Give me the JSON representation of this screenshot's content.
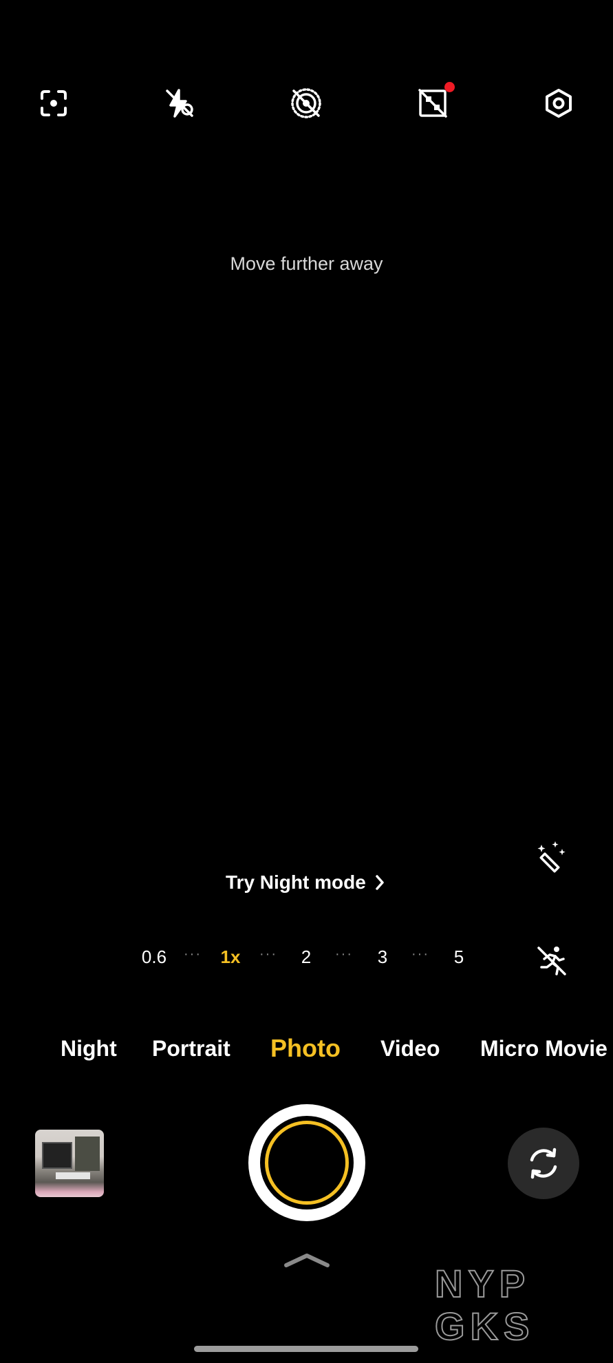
{
  "toolbar": {
    "items": [
      {
        "icon": "scan-icon"
      },
      {
        "icon": "flash-off-icon"
      },
      {
        "icon": "live-photo-off-icon"
      },
      {
        "icon": "aspect-ratio-off-icon",
        "badge_color": "#ef1b25"
      },
      {
        "icon": "settings-icon"
      }
    ]
  },
  "hint": "Move further away",
  "night_prompt": {
    "label": "Try Night mode"
  },
  "zoom": {
    "levels": [
      "0.6",
      "1x",
      "2",
      "3",
      "5"
    ],
    "active": "1x",
    "dots": "···"
  },
  "modes": {
    "items": [
      "Night",
      "Portrait",
      "Photo",
      "Video",
      "Micro Movie"
    ],
    "active": "Photo"
  },
  "colors": {
    "accent": "#f5c023",
    "background": "#000000"
  },
  "watermark": {
    "line1": "NYP",
    "line2": "GKS"
  }
}
